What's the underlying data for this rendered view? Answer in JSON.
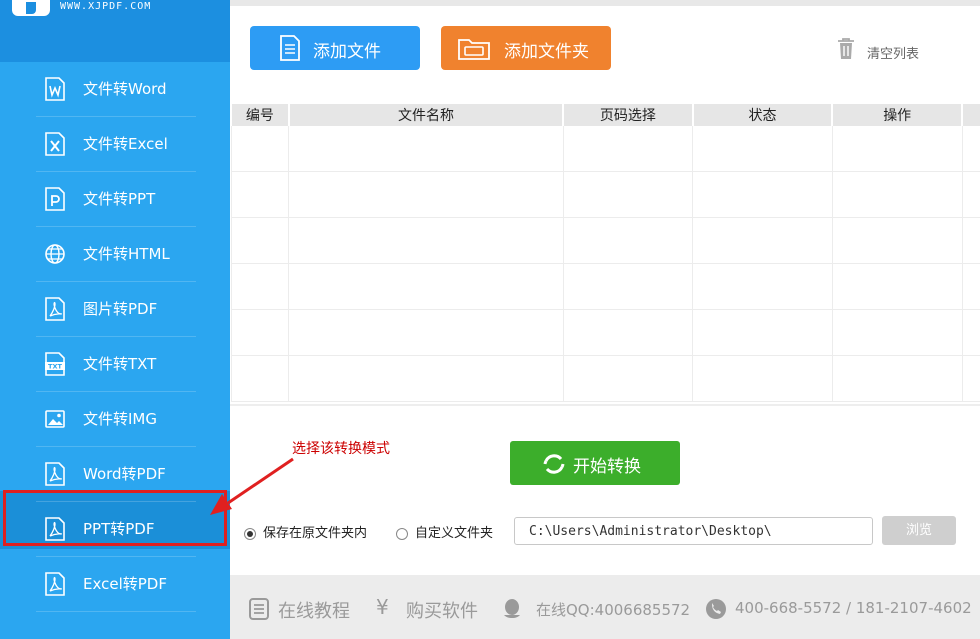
{
  "brand": {
    "url": "WWW.XJPDF.COM"
  },
  "sidebar": {
    "items": [
      {
        "label": "文件转Word",
        "icon": "word-icon"
      },
      {
        "label": "文件转Excel",
        "icon": "excel-icon"
      },
      {
        "label": "文件转PPT",
        "icon": "ppt-icon"
      },
      {
        "label": "文件转HTML",
        "icon": "globe-icon"
      },
      {
        "label": "图片转PDF",
        "icon": "pdf-icon"
      },
      {
        "label": "文件转TXT",
        "icon": "txt-icon"
      },
      {
        "label": "文件转IMG",
        "icon": "image-icon"
      },
      {
        "label": "Word转PDF",
        "icon": "pdf-icon"
      },
      {
        "label": "PPT转PDF",
        "icon": "pdf-icon",
        "active": true
      },
      {
        "label": "Excel转PDF",
        "icon": "pdf-icon"
      }
    ]
  },
  "toolbar": {
    "add_file": "添加文件",
    "add_folder": "添加文件夹",
    "clear_list": "清空列表"
  },
  "table": {
    "headers": [
      "编号",
      "文件名称",
      "页码选择",
      "状态",
      "操作"
    ],
    "rows": []
  },
  "annotation": {
    "text": "选择该转换模式"
  },
  "actions": {
    "start": "开始转换",
    "browse": "浏览"
  },
  "output": {
    "option_original": "保存在原文件夹内",
    "option_custom": "自定义文件夹",
    "selected": "original",
    "path": "C:\\Users\\Administrator\\Desktop\\"
  },
  "footer": {
    "tutorial": "在线教程",
    "buy": "购买软件",
    "qq": "在线QQ:4006685572",
    "phone": "400-668-5572 / 181-2107-4602"
  },
  "colors": {
    "sidebar_bg": "#2ba6f0",
    "add_file_btn": "#2d9cf4",
    "add_folder_btn": "#f0822e",
    "start_btn": "#3cae2b",
    "annotation_red": "#e02020"
  }
}
